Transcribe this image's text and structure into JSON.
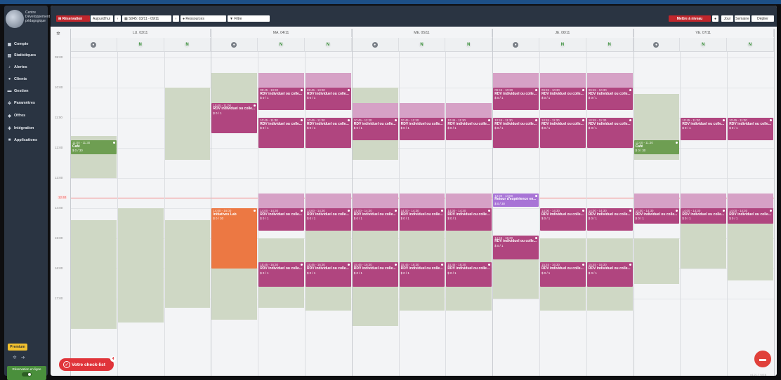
{
  "sidebar": {
    "brand": "Centre Développement pédagogique",
    "items": [
      {
        "label": "Compte",
        "icon": "store-icon"
      },
      {
        "label": "Statistiques",
        "icon": "chart-icon"
      },
      {
        "label": "Alertes",
        "icon": "bell-icon"
      },
      {
        "label": "Clients",
        "icon": "user-icon"
      },
      {
        "label": "Gestion",
        "icon": "briefcase-icon"
      },
      {
        "label": "Paramètres",
        "icon": "cog-icon"
      },
      {
        "label": "Offres",
        "icon": "tag-icon"
      },
      {
        "label": "Intégration",
        "icon": "puzzle-icon"
      },
      {
        "label": "Applications",
        "icon": "grid-icon"
      }
    ],
    "premium": "Premium",
    "reservation": "Réservation en ligne"
  },
  "toolbar": {
    "new": "Réservation",
    "today": "Aujourd'hui",
    "prev": "‹",
    "week": "S045: 03/11 - 09/11",
    "next": "›",
    "resources": "Ressources",
    "filter": "Filtre",
    "level": "Mettre à niveau",
    "day": "Jour",
    "semaine": "Semaine",
    "unfolded": "Déplier"
  },
  "days": [
    "LU. 03/11",
    "MA. 04/11",
    "ME. 05/11",
    "JE. 06/11",
    "VE. 07/11"
  ],
  "hours": [
    "09:00",
    "10:00",
    "11:00",
    "12:00",
    "13:00",
    "14:00",
    "15:00",
    "16:00",
    "17:00"
  ],
  "now": "12:40",
  "event_titles": {
    "rdv": "RDV individuel ou colle...",
    "cafe": "Café",
    "orange": "Initiatives Lab",
    "violet": "Retour d'expérience en...",
    "cap_rdv": "0 / 1",
    "cap_cafe": "0 / 30"
  },
  "checklist": "Votre check-list",
  "checklist_badge": "4",
  "version": "v4.21.7 WEB"
}
